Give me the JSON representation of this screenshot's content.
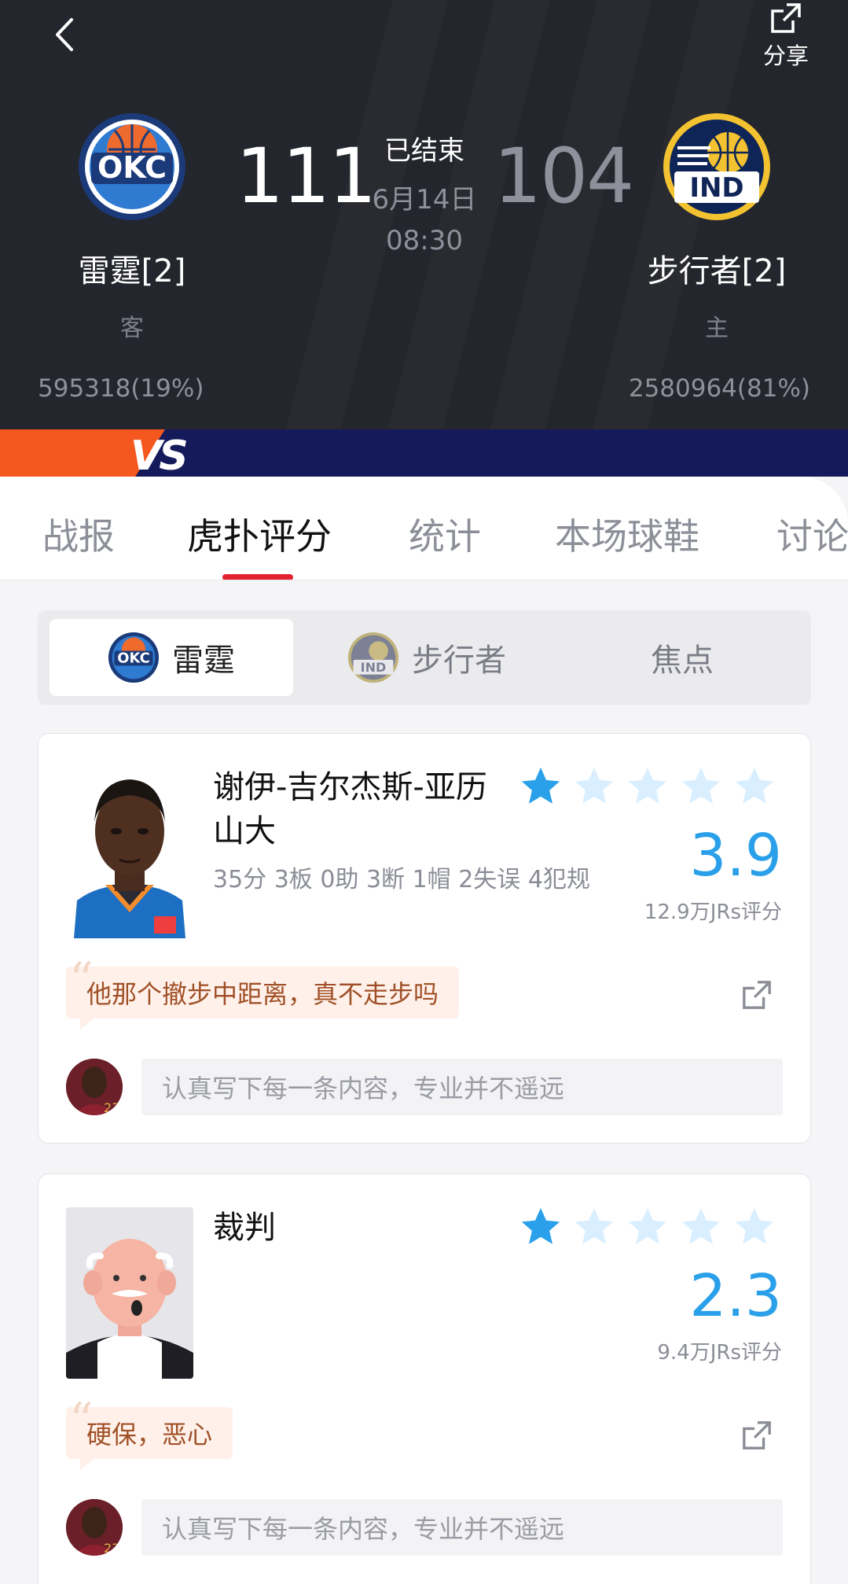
{
  "header": {
    "back_icon": "chevron-left-icon",
    "share_icon": "share-icon",
    "share_label": "分享",
    "status": "已结束",
    "date": "6月14日",
    "time": "08:30",
    "away": {
      "name": "雷霆[2]",
      "role": "客",
      "score": "111",
      "support": "595318(19%)",
      "logo": "OKC"
    },
    "home": {
      "name": "步行者[2]",
      "role": "主",
      "score": "104",
      "support": "2580964(81%)",
      "logo": "IND"
    }
  },
  "vs_bar": {
    "label": "VS",
    "away_share": 0.19,
    "home_share": 0.81,
    "colors": {
      "away": "#f5581f",
      "home": "#151a5a"
    }
  },
  "tabs": [
    "战报",
    "虎扑评分",
    "统计",
    "本场球鞋",
    "讨论"
  ],
  "active_tab": "虎扑评分",
  "team_selector": {
    "items": [
      "雷霆",
      "步行者",
      "焦点"
    ],
    "active": "雷霆"
  },
  "ratings": [
    {
      "name": "谢伊-吉尔杰斯-亚历山大",
      "stats": "35分 3板 0助 3断 1帽 2失误 4犯规",
      "stars_filled": 1,
      "stars_total": 5,
      "rating": "3.9",
      "rating_count": "12.9万JRs评分",
      "top_comment": "他那个撤步中距离，真不走步吗",
      "input_placeholder": "认真写下每一条内容，专业并不遥远"
    },
    {
      "name": "裁判",
      "stats": "",
      "stars_filled": 1,
      "stars_total": 5,
      "rating": "2.3",
      "rating_count": "9.4万JRs评分",
      "top_comment": "硬保，恶心",
      "input_placeholder": "认真写下每一条内容，专业并不遥远"
    }
  ],
  "colors": {
    "accent": "#2aa0ea",
    "tab_indicator": "#e32331",
    "star_filled": "#2aa0ea",
    "star_empty": "#d9efff"
  }
}
